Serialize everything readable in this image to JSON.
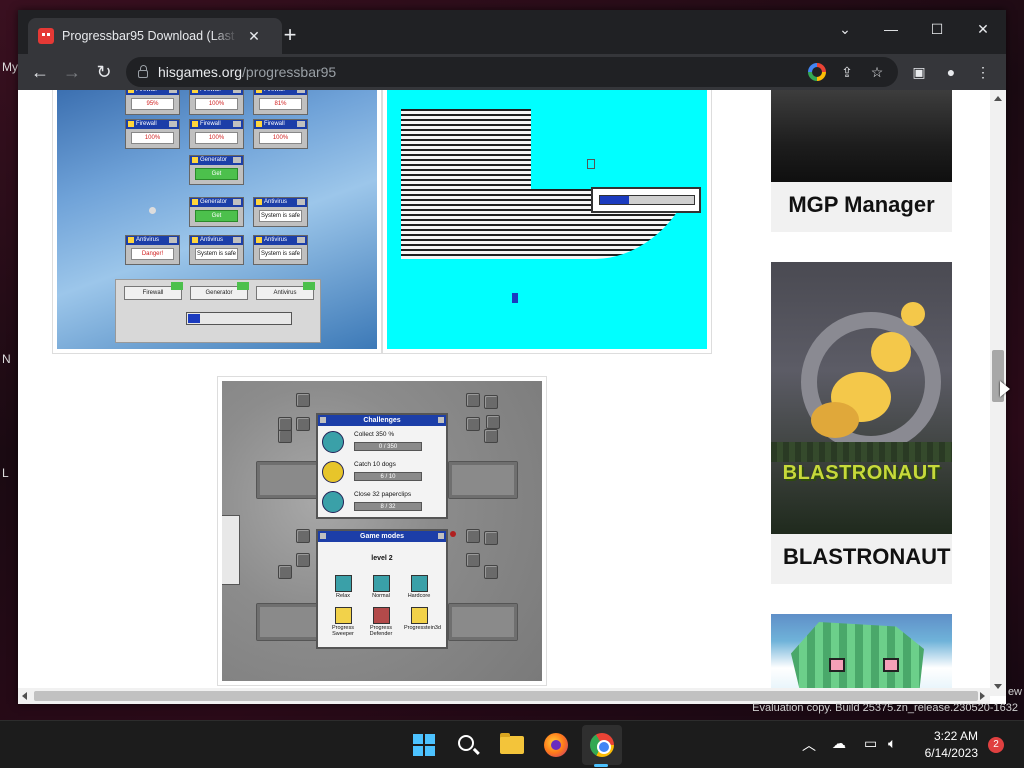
{
  "desktop": {
    "fragments": [
      "My",
      "N",
      "L"
    ]
  },
  "browser": {
    "tab_title": "Progressbar95 Download (Last V",
    "url_host": "hisgames.org",
    "url_path": "/progressbar95"
  },
  "screens": {
    "s1": {
      "windows": [
        {
          "title": "Firewall",
          "value": "95%"
        },
        {
          "title": "Firewall",
          "value": "100%"
        },
        {
          "title": "Firewall",
          "value": "81%"
        },
        {
          "title": "Firewall",
          "value": "100%"
        },
        {
          "title": "Firewall",
          "value": "100%"
        },
        {
          "title": "Firewall",
          "value": "100%"
        },
        {
          "title": "Generator",
          "value": "Get"
        },
        {
          "title": "Generator",
          "value": "Get"
        },
        {
          "title": "Antivirus",
          "value": "System is safe"
        },
        {
          "title": "Antivirus",
          "value": "Danger!"
        },
        {
          "title": "Antivirus",
          "value": "System is safe"
        },
        {
          "title": "Antivirus",
          "value": "System is safe"
        }
      ],
      "task_buttons": [
        "Firewall",
        "Generator",
        "Antivirus"
      ],
      "progress": 0.12
    },
    "s2": {
      "progress": 0.3
    },
    "s3": {
      "challenges_title": "Challenges",
      "challenges": [
        {
          "label": "Collect 350 %",
          "value": "0 / 350"
        },
        {
          "label": "Catch 10 dogs",
          "value": "6 / 10"
        },
        {
          "label": "Close 32 paperclips",
          "value": "8 / 32"
        }
      ],
      "modes_title": "Game modes",
      "level": "level 2",
      "modes": [
        {
          "label": "Relax",
          "color": "t"
        },
        {
          "label": "Normal",
          "color": "t"
        },
        {
          "label": "Hardcore",
          "color": "t"
        },
        {
          "label": "Progress Sweeper",
          "color": "y"
        },
        {
          "label": "Progress Defender",
          "color": "r"
        },
        {
          "label": "Progresstein3d",
          "color": "y"
        }
      ]
    }
  },
  "sidebar": {
    "games": [
      "MGP Manager",
      "BLASTRONAUT"
    ],
    "blast_logo": "BLASTRONAUT"
  },
  "system": {
    "watermark": "Evaluation copy. Build 25375.zn_release.230520-1632",
    "watermark_top": "ew",
    "time": "3:22 AM",
    "date": "6/14/2023",
    "notifications": "2"
  },
  "colors": {
    "accent": "#4cc2ff",
    "win95_title": "#1c3ea8",
    "cyan_bg": "#00ffff"
  }
}
